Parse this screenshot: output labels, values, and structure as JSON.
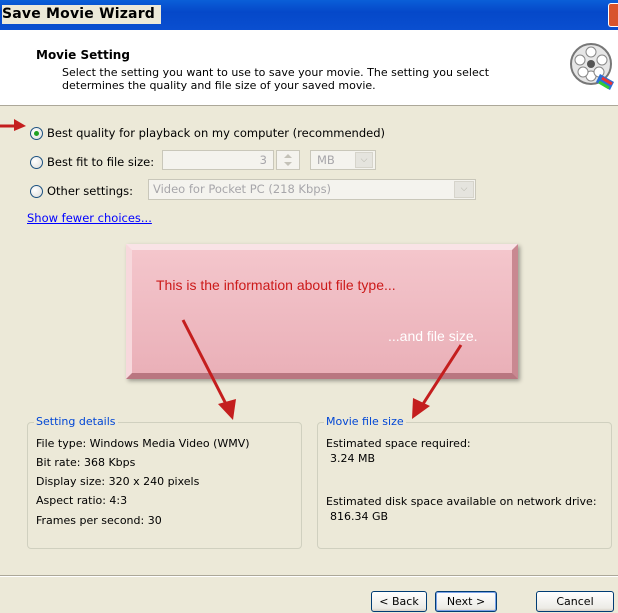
{
  "window": {
    "title": "Save Movie Wizard"
  },
  "header": {
    "title": "Movie Setting",
    "description": "Select the setting you want to use to save your movie. The setting you select determines the quality and file size of your saved movie."
  },
  "options": {
    "best_quality_label": "Best quality for playback on my computer (recommended)",
    "best_fit_label": "Best fit to file size:",
    "best_fit_value": "3",
    "best_fit_unit": "MB",
    "other_label": "Other settings:",
    "other_value": "Video for Pocket PC (218 Kbps)",
    "show_fewer": "Show fewer choices...",
    "selected": "best_quality"
  },
  "callout": {
    "line1": "This is the information about file type...",
    "line2": "...and file size."
  },
  "setting_details": {
    "legend": "Setting details",
    "file_type": "File type: Windows Media Video (WMV)",
    "bit_rate": "Bit rate: 368 Kbps",
    "display_size": "Display size: 320 x 240 pixels",
    "aspect_ratio": "Aspect ratio: 4:3",
    "fps": "Frames per second: 30"
  },
  "movie_file_size": {
    "legend": "Movie file size",
    "est_space_label": "Estimated space required:",
    "est_space_value": "3.24 MB",
    "disk_label": "Estimated disk space available on network drive:",
    "disk_value": "816.34 GB"
  },
  "buttons": {
    "back": "< Back",
    "next": "Next >",
    "cancel": "Cancel"
  },
  "colors": {
    "link": "#0000ff",
    "legend": "#0046d5",
    "callout_text": "#cc1a1a",
    "arrow": "#c41e1e"
  },
  "icons": {
    "header": "film-reel-icon",
    "pointer": "red-arrow-icon"
  }
}
